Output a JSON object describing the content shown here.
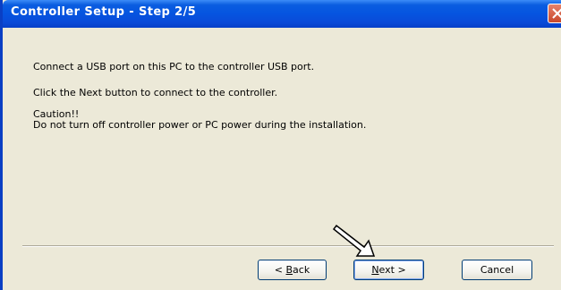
{
  "window": {
    "title": "Controller Setup - Step 2/5"
  },
  "messages": {
    "line1": "Connect a USB port on this PC to the controller USB port.",
    "line2": "Click the Next button to connect to the controller.",
    "caution_title": "Caution!!",
    "caution_body": "Do not turn off controller power or PC power during the installation."
  },
  "buttons": {
    "back": {
      "prefix": "< ",
      "accel": "B",
      "rest": "ack"
    },
    "next": {
      "accel": "N",
      "rest": "ext >"
    },
    "cancel": {
      "label": "Cancel"
    }
  },
  "colors": {
    "titlebar": "#0554e0",
    "dialog_bg": "#ece9d8",
    "button_border": "#003c74"
  }
}
